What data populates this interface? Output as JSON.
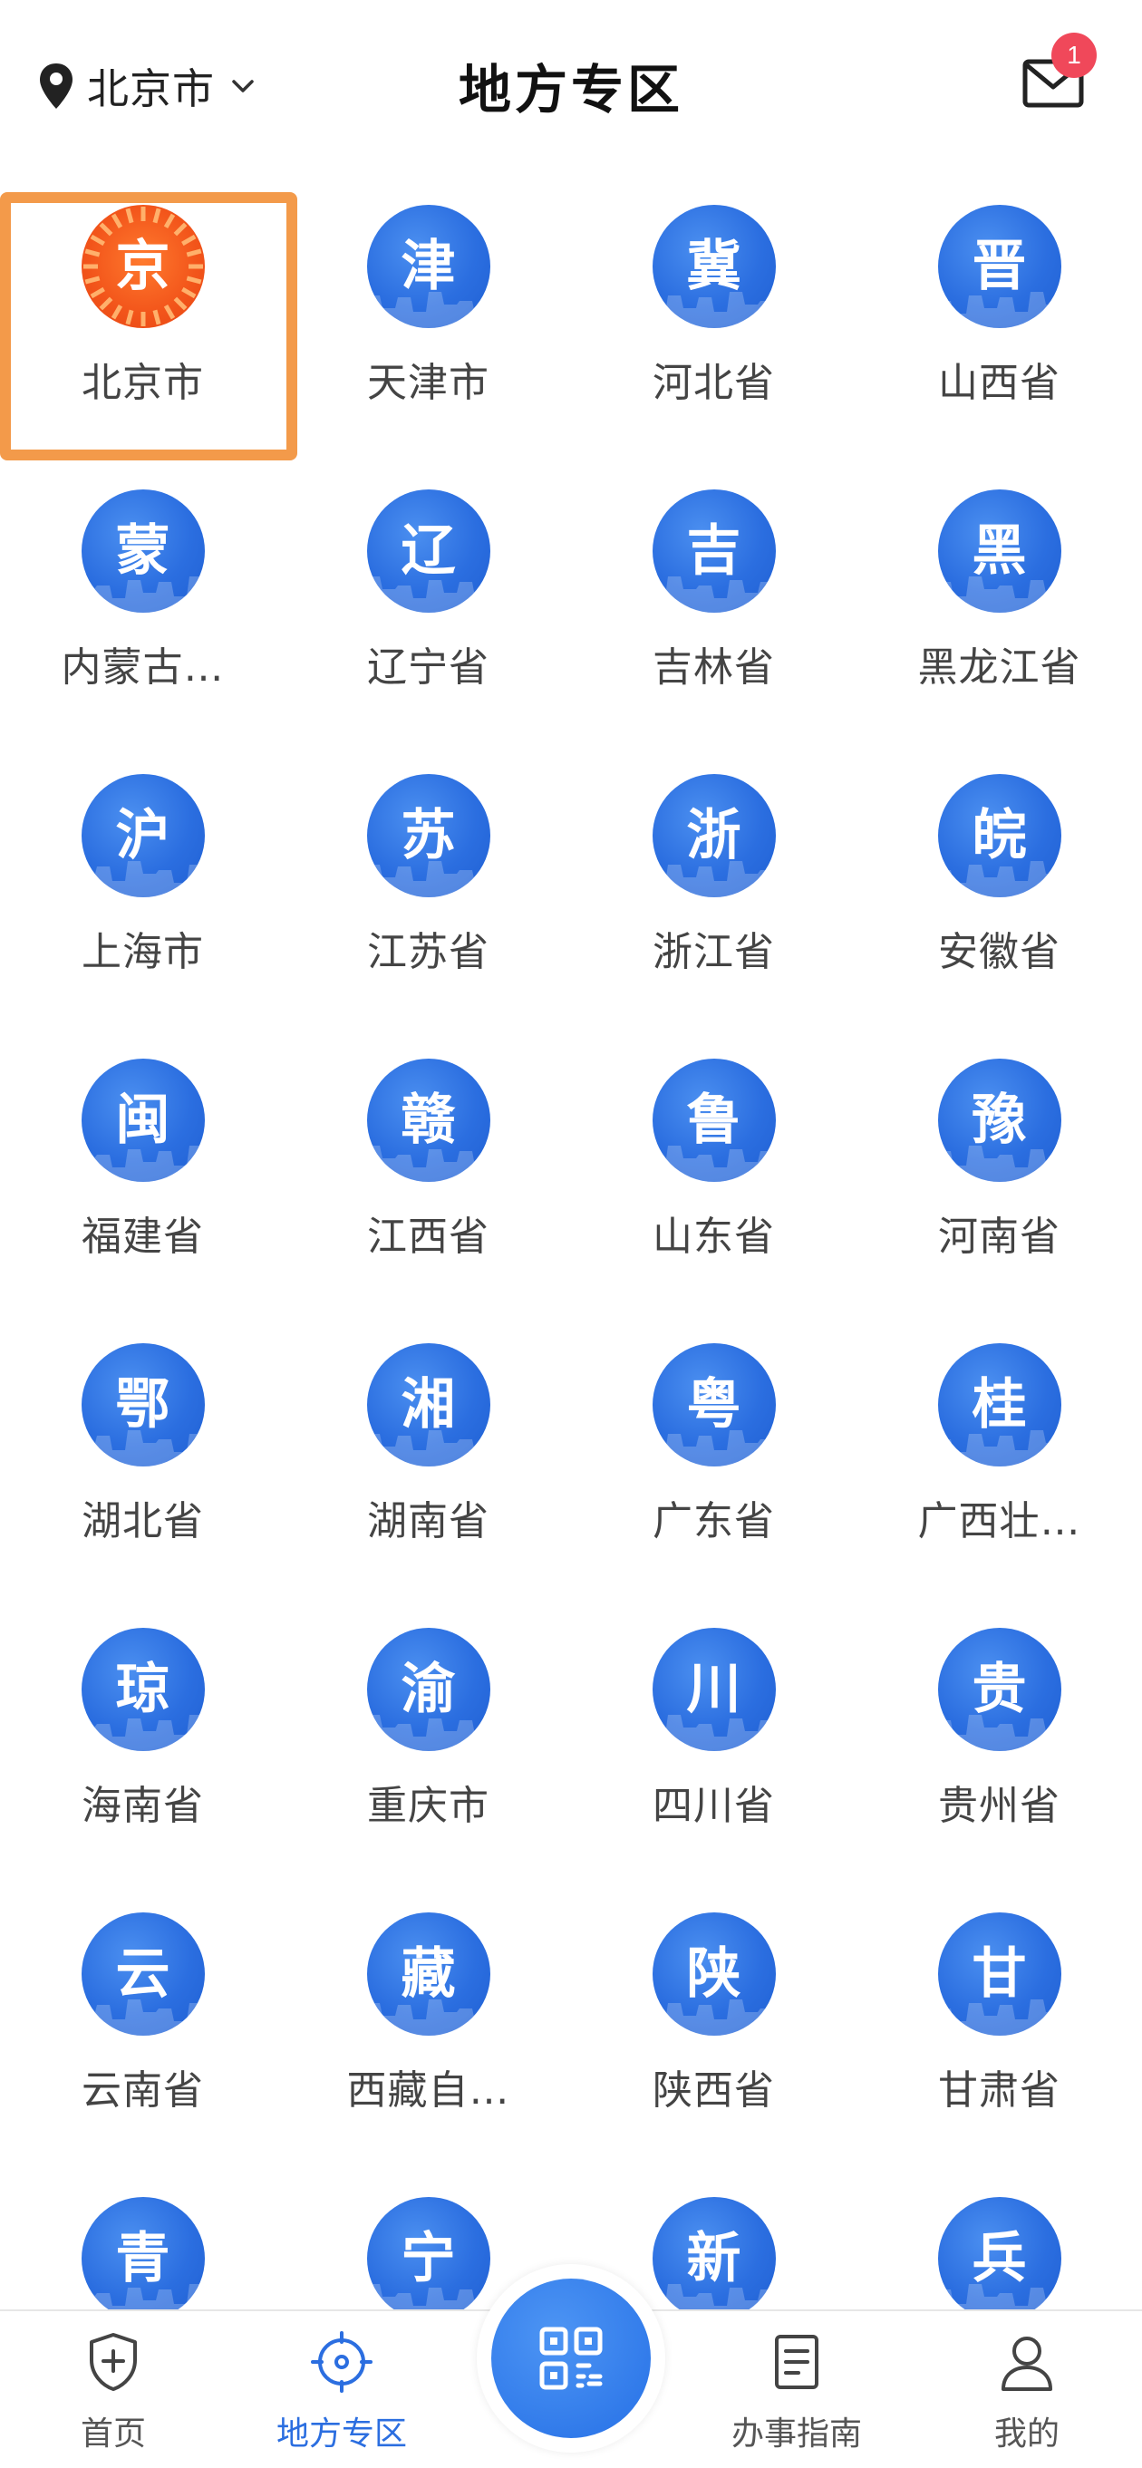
{
  "header": {
    "location": "北京市",
    "title": "地方专区",
    "mail_badge": "1"
  },
  "regions": [
    {
      "char": "京",
      "label": "北京市",
      "selected": true
    },
    {
      "char": "津",
      "label": "天津市"
    },
    {
      "char": "冀",
      "label": "河北省"
    },
    {
      "char": "晋",
      "label": "山西省"
    },
    {
      "char": "蒙",
      "label": "内蒙古…"
    },
    {
      "char": "辽",
      "label": "辽宁省"
    },
    {
      "char": "吉",
      "label": "吉林省"
    },
    {
      "char": "黑",
      "label": "黑龙江省"
    },
    {
      "char": "沪",
      "label": "上海市"
    },
    {
      "char": "苏",
      "label": "江苏省"
    },
    {
      "char": "浙",
      "label": "浙江省"
    },
    {
      "char": "皖",
      "label": "安徽省"
    },
    {
      "char": "闽",
      "label": "福建省"
    },
    {
      "char": "赣",
      "label": "江西省"
    },
    {
      "char": "鲁",
      "label": "山东省"
    },
    {
      "char": "豫",
      "label": "河南省"
    },
    {
      "char": "鄂",
      "label": "湖北省"
    },
    {
      "char": "湘",
      "label": "湖南省"
    },
    {
      "char": "粤",
      "label": "广东省"
    },
    {
      "char": "桂",
      "label": "广西壮…"
    },
    {
      "char": "琼",
      "label": "海南省"
    },
    {
      "char": "渝",
      "label": "重庆市"
    },
    {
      "char": "川",
      "label": "四川省"
    },
    {
      "char": "贵",
      "label": "贵州省"
    },
    {
      "char": "云",
      "label": "云南省"
    },
    {
      "char": "藏",
      "label": "西藏自…"
    },
    {
      "char": "陕",
      "label": "陕西省"
    },
    {
      "char": "甘",
      "label": "甘肃省"
    },
    {
      "char": "青",
      "label": ""
    },
    {
      "char": "宁",
      "label": ""
    },
    {
      "char": "新",
      "label": ""
    },
    {
      "char": "兵",
      "label": ""
    }
  ],
  "nav": {
    "home": "首页",
    "local": "地方专区",
    "guide": "办事指南",
    "mine": "我的"
  },
  "colors": {
    "accent": "#2b6ee0",
    "selected_orange": "#f2541a",
    "highlight_frame": "#f39a4a",
    "badge": "#f0485a"
  },
  "icons": {
    "location": "map-pin-icon",
    "mail": "mail-icon",
    "home": "shield-plus-icon",
    "local": "crosshair-icon",
    "scan": "qr-code-icon",
    "guide": "document-icon",
    "mine": "person-icon"
  }
}
